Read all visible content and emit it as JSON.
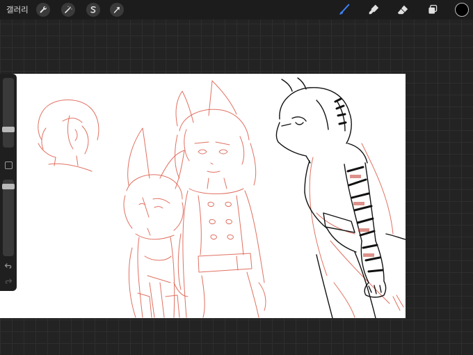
{
  "topbar": {
    "gallery_label": "갤러리",
    "left_tools": [
      {
        "name": "actions",
        "icon": "wrench-icon"
      },
      {
        "name": "adjustments",
        "icon": "magic-wand-icon"
      },
      {
        "name": "selection",
        "icon": "selection-s-icon"
      },
      {
        "name": "transform",
        "icon": "arrow-cursor-icon"
      }
    ],
    "right_tools": [
      {
        "name": "brush",
        "icon": "brush-icon",
        "active": true
      },
      {
        "name": "smudge",
        "icon": "smudge-icon"
      },
      {
        "name": "eraser",
        "icon": "eraser-icon"
      },
      {
        "name": "layers",
        "icon": "layers-icon"
      }
    ],
    "current_color": "#000000",
    "active_tool_color": "#3b82f6"
  },
  "sidebar": {
    "brush_size": 0.5,
    "opacity": 0.9
  },
  "canvas": {
    "sketch_color": "#e07060",
    "ink_color": "#111111"
  }
}
